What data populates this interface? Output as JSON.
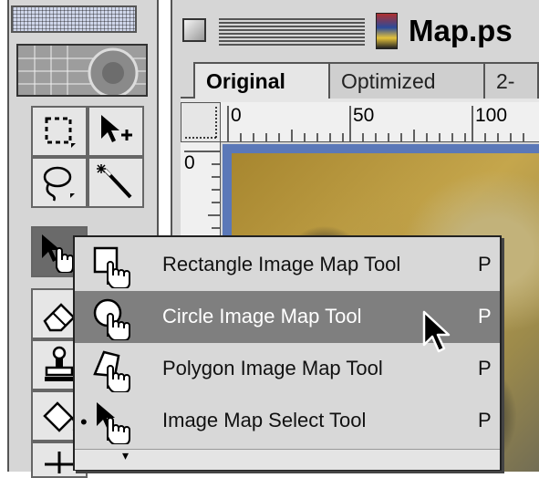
{
  "toolbox": {
    "tools": [
      {
        "name": "rectangular-marquee"
      },
      {
        "name": "move-selection"
      },
      {
        "name": "lasso"
      },
      {
        "name": "magic-wand"
      },
      {
        "name": "image-map-select",
        "pressed": true
      },
      {
        "name": "eraser"
      },
      {
        "name": "stamp"
      },
      {
        "name": "paint-bucket"
      }
    ]
  },
  "window": {
    "title": "Map.ps"
  },
  "tabs": [
    {
      "label": "Original",
      "active": true
    },
    {
      "label": "Optimized",
      "active": false
    },
    {
      "label": "2-",
      "active": false
    }
  ],
  "rulers": {
    "horizontal": [
      "0",
      "50",
      "100"
    ],
    "vertical": [
      "0"
    ]
  },
  "flyout": {
    "items": [
      {
        "label": "Rectangle Image Map Tool",
        "shortcut": "P",
        "icon": "rectangle-image-map-icon",
        "highlighted": false,
        "selected": false
      },
      {
        "label": "Circle Image Map Tool",
        "shortcut": "P",
        "icon": "circle-image-map-icon",
        "highlighted": true,
        "selected": false
      },
      {
        "label": "Polygon Image Map Tool",
        "shortcut": "P",
        "icon": "polygon-image-map-icon",
        "highlighted": false,
        "selected": false
      },
      {
        "label": "Image Map Select Tool",
        "shortcut": "P",
        "icon": "image-map-select-icon",
        "highlighted": false,
        "selected": true
      }
    ],
    "more_indicator": "▾",
    "selected_bullet": "•"
  },
  "colors": {
    "highlight": "#7f7f7f",
    "menu_bg": "#d8d8d8",
    "canvas_border": "#5b78b8"
  }
}
